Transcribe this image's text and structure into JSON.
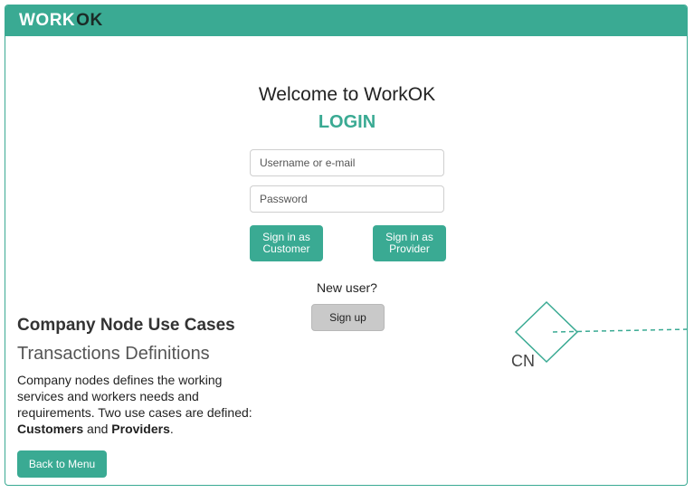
{
  "header": {
    "logo_work": "WORK",
    "logo_o": "O",
    "logo_k": "K"
  },
  "login": {
    "welcome": "Welcome to WorkOK",
    "title": "LOGIN",
    "username_placeholder": "Username or e-mail",
    "password_placeholder": "Password",
    "customer_button_line1": "Sign in as",
    "customer_button_line2": "Customer",
    "provider_button_line1": "Sign in as",
    "provider_button_line2": "Provider",
    "new_user": "New user?",
    "signup_label": "Sign up"
  },
  "use_case": {
    "title": "Company Node Use Cases",
    "subtitle": "Transactions Definitions",
    "desc_part1": "Company nodes defines the working services and workers needs and requirements. Two use cases are defined: ",
    "desc_bold1": "Customers",
    "desc_and": " and ",
    "desc_bold2": "Providers",
    "desc_end": ".",
    "back_label": "Back to Menu"
  },
  "diagram": {
    "node_label": "CN"
  },
  "colors": {
    "accent": "#3aaa93",
    "signup_bg": "#c9c9c9"
  }
}
